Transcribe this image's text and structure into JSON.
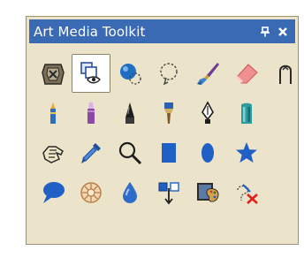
{
  "panel": {
    "title": "Art Media Toolkit",
    "pin_icon": "pin-icon",
    "close_icon": "close-icon"
  },
  "tools": [
    "gloves-tool",
    "selection-tool",
    "fill-tool",
    "lasso-tool",
    "brush-tool",
    "eraser-tool",
    "stencil-tool",
    "crayon-tool",
    "marker-tool",
    "chalk-tool",
    "paint-brush-tool",
    "pen-nib-tool",
    "paint-tube-tool",
    "hand-tool",
    "pipette-tool",
    "zoom-tool",
    "rectangle-tool",
    "ellipse-tool",
    "star-tool",
    "speech-bubble-tool",
    "sticker-tool",
    "water-drop-tool",
    "flip-tool",
    "palette-tool",
    "clear-tool"
  ],
  "selected_tool": "selection-tool"
}
